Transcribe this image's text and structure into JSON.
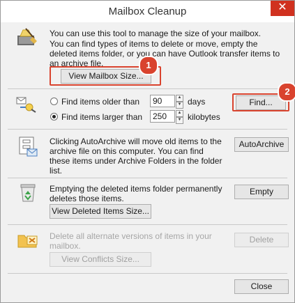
{
  "window": {
    "title": "Mailbox Cleanup",
    "close_glyph": "✕"
  },
  "section_size": {
    "line1": "You can use this tool to manage the size of your mailbox.",
    "line2": "You can find types of items to delete or move, empty the deleted items folder, or you can have Outlook transfer items to an archive file.",
    "view_size_label": "View Mailbox Size...",
    "badge": "1"
  },
  "section_find": {
    "older_label": "Find items older than",
    "older_value": "90",
    "older_unit": "days",
    "larger_label": "Find items larger than",
    "larger_value": "250",
    "larger_unit": "kilobytes",
    "find_label": "Find...",
    "badge": "2"
  },
  "section_archive": {
    "text": "Clicking AutoArchive will move old items to the archive file on this computer. You can find these items under Archive Folders in the folder list.",
    "button_label": "AutoArchive"
  },
  "section_deleted": {
    "text": "Emptying the deleted items folder permanently deletes those items.",
    "empty_label": "Empty",
    "view_label": "View Deleted Items Size..."
  },
  "section_conflicts": {
    "text": "Delete all alternate versions of items in your mailbox.",
    "delete_label": "Delete",
    "view_label": "View Conflicts Size..."
  },
  "footer": {
    "close_label": "Close"
  }
}
